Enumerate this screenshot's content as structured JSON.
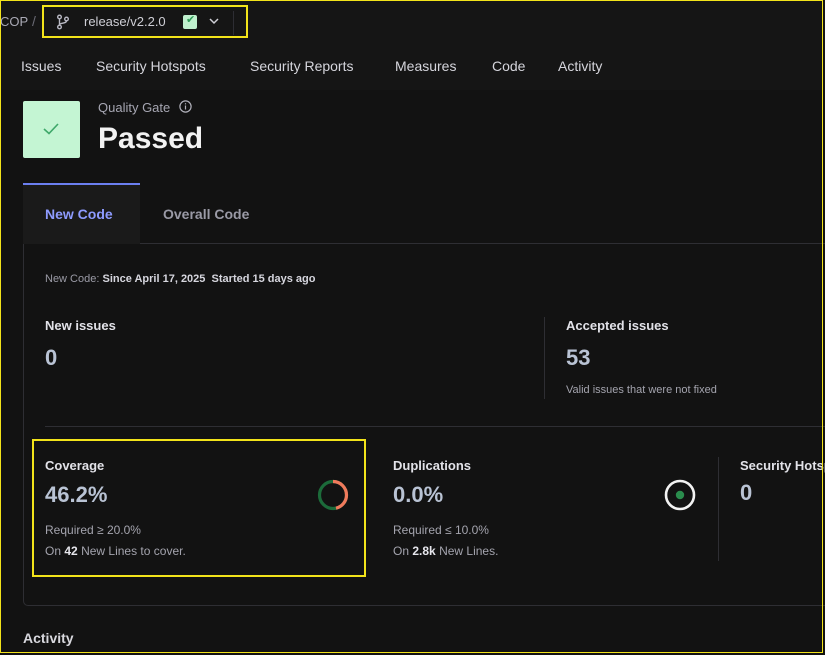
{
  "breadcrumb": {
    "project": "COP",
    "separator": "/",
    "branch": "release/v2.2.0"
  },
  "nav": {
    "items": [
      "Issues",
      "Security Hotspots",
      "Security Reports",
      "Measures",
      "Code",
      "Activity"
    ]
  },
  "quality_gate": {
    "label": "Quality Gate",
    "status": "Passed"
  },
  "tabs": {
    "new_code": "New Code",
    "overall_code": "Overall Code"
  },
  "new_code_period": {
    "prefix": "New Code:",
    "since": "Since April 17, 2025",
    "started": "Started 15 days ago"
  },
  "metrics": {
    "new_issues": {
      "label": "New issues",
      "value": "0"
    },
    "accepted_issues": {
      "label": "Accepted issues",
      "value": "53",
      "note": "Valid issues that were not fixed"
    },
    "coverage": {
      "label": "Coverage",
      "value": "46.2%",
      "required": "Required ≥ 20.0%",
      "on": "On",
      "lines_count": "42",
      "lines_text": "New Lines to cover.",
      "fraction": 0.462
    },
    "duplications": {
      "label": "Duplications",
      "value": "0.0%",
      "required": "Required ≤ 10.0%",
      "on": "On",
      "lines_count": "2.8k",
      "lines_text": "New Lines."
    },
    "security_hotspots": {
      "label": "Security Hotspots",
      "value": "0"
    }
  },
  "section": {
    "activity": "Activity"
  },
  "colors": {
    "accent": "#8e9bff",
    "success": "#2e9b57",
    "coverage_low": "#f07a5c",
    "highlight": "#f2e31a"
  }
}
